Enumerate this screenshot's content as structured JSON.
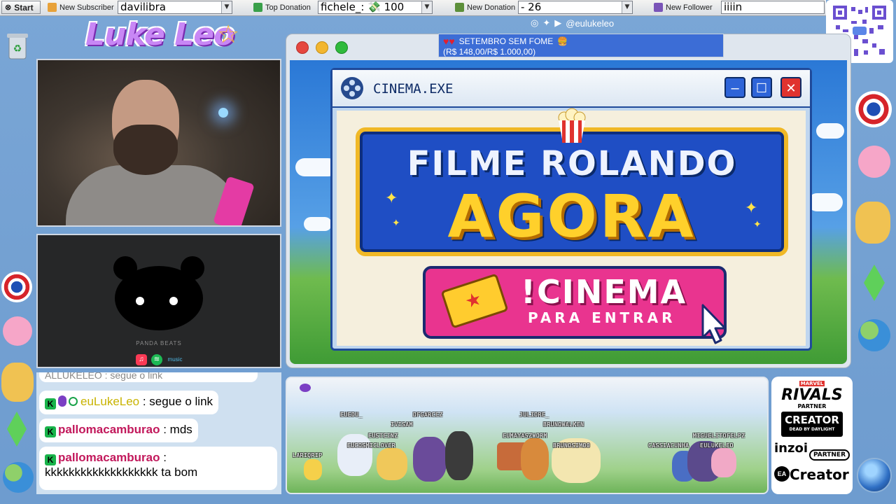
{
  "taskbar": {
    "start_label": "Start",
    "new_subscriber_label": "New Subscriber",
    "new_subscriber_value": "davilibra",
    "top_donation_label": "Top Donation",
    "top_donation_value": "fichele_: 💸 100",
    "new_donation_label": "New Donation",
    "new_donation_value": "- 26",
    "new_follower_label": "New Follower",
    "new_follower_value": "iiiin"
  },
  "logo": {
    "text": "Luke Leo"
  },
  "social": {
    "handle": "@eulukeleo"
  },
  "banner": {
    "line1": "SETEMBRO SEM FOME",
    "line2": "(R$ 148,00/R$ 1.000,00)",
    "hearts": "♥♥"
  },
  "music": {
    "label": "PANDA BEATS",
    "music_text": "music"
  },
  "chat": {
    "partial": "ALLUKELEO : segue o link",
    "messages": [
      {
        "user": "euLukeLeo",
        "text": " : segue o link"
      },
      {
        "user": "pallomacamburao",
        "text": " : mds"
      },
      {
        "user": "pallomacamburao",
        "text": " :",
        "text2": "kkkkkkkkkkkkkkkkkkk ta bom"
      }
    ]
  },
  "cinema": {
    "title": "CINEMA.EXE",
    "line1": "FILME ROLANDO",
    "line2": "AGORA",
    "cta_main": "!CINEMA",
    "cta_sub": "PARA ENTRAR",
    "minimize": "–",
    "maximize": "☐",
    "close": "✕"
  },
  "pokemon_names": [
    "EUEDU_",
    "DFGARCEZ",
    "JULIDRE_",
    "IVISAM",
    "BRUNOWALKEN",
    "EUSTEINZ",
    "EUMAYASZWORM",
    "MIGUELITOFELPZ",
    "EUCOSMICLOVER",
    "BRUNOSIM00",
    "CASSIACUNHA",
    "EULUKELEO",
    "LARIQRIP"
  ],
  "partners": {
    "marvel": "MARVEL",
    "rivals": "RIVALS",
    "partner1": "PARTNER",
    "creator": "CREATOR",
    "dbd": "DEAD BY DAYLIGHT",
    "inzoi": "inzoi",
    "partner2": "PARTNER",
    "ea": "EA",
    "ea_creator": "Creator"
  },
  "colors": {
    "accent": "#e9348f",
    "chat_bg": "#cfe0f0",
    "window_blue": "#1f4ec4",
    "gold": "#ffd02b"
  }
}
